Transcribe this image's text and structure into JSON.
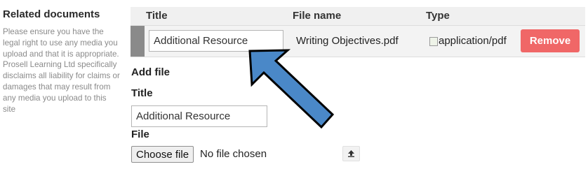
{
  "sidebar": {
    "title": "Related documents",
    "description": "Please ensure you have the legal right to use any media you upload and that it is appropriate. Prosell Learning Ltd specifically disclaims all liability for claims or damages that may result from any media you upload to this site"
  },
  "table": {
    "headers": {
      "title": "Title",
      "file_name": "File name",
      "type": "Type"
    },
    "rows": [
      {
        "title": "Additional Resource",
        "file_name": "Writing Objectives.pdf",
        "type_alt": "application/pdf",
        "remove_label": "Remove"
      }
    ]
  },
  "add_file": {
    "heading": "Add file",
    "title_label": "Title",
    "title_value": "Additional Resource",
    "file_label": "File",
    "choose_label": "Choose file",
    "no_file_text": "No file chosen",
    "upload_icon": "upload-icon"
  },
  "annotation": {
    "arrow_icon": "blue-arrow-icon",
    "arrow_color": "#4a88c8"
  },
  "colors": {
    "remove": "#f06767",
    "handle": "#8a8a8a",
    "header_bg": "#f0f0f0"
  }
}
